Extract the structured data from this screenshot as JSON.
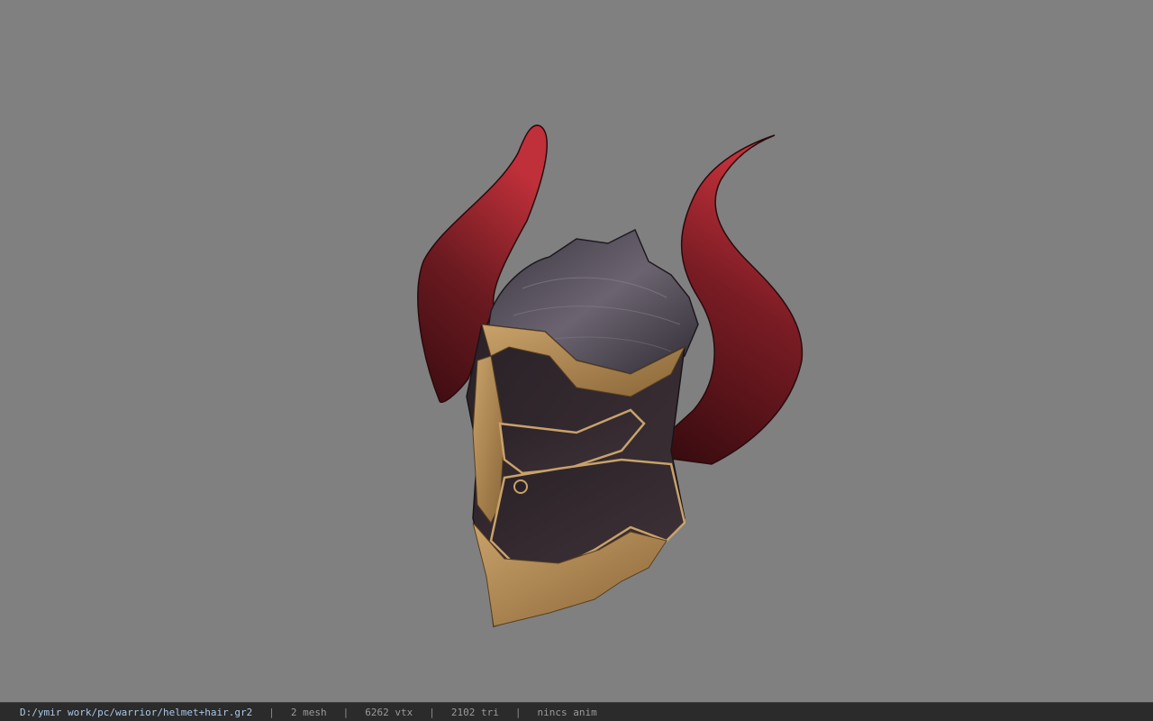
{
  "viewport": {
    "background": "#808080",
    "model_name": "helmet+hair"
  },
  "statusbar": {
    "file_path": "D:/ymir work/pc/warrior/helmet+hair.gr2",
    "separator": "|",
    "mesh_count": "2 mesh",
    "vertex_count": "6262 vtx",
    "triangle_count": "2102 tri",
    "anim_status": "nincs anim",
    "path_color": "#a9c7e6"
  }
}
